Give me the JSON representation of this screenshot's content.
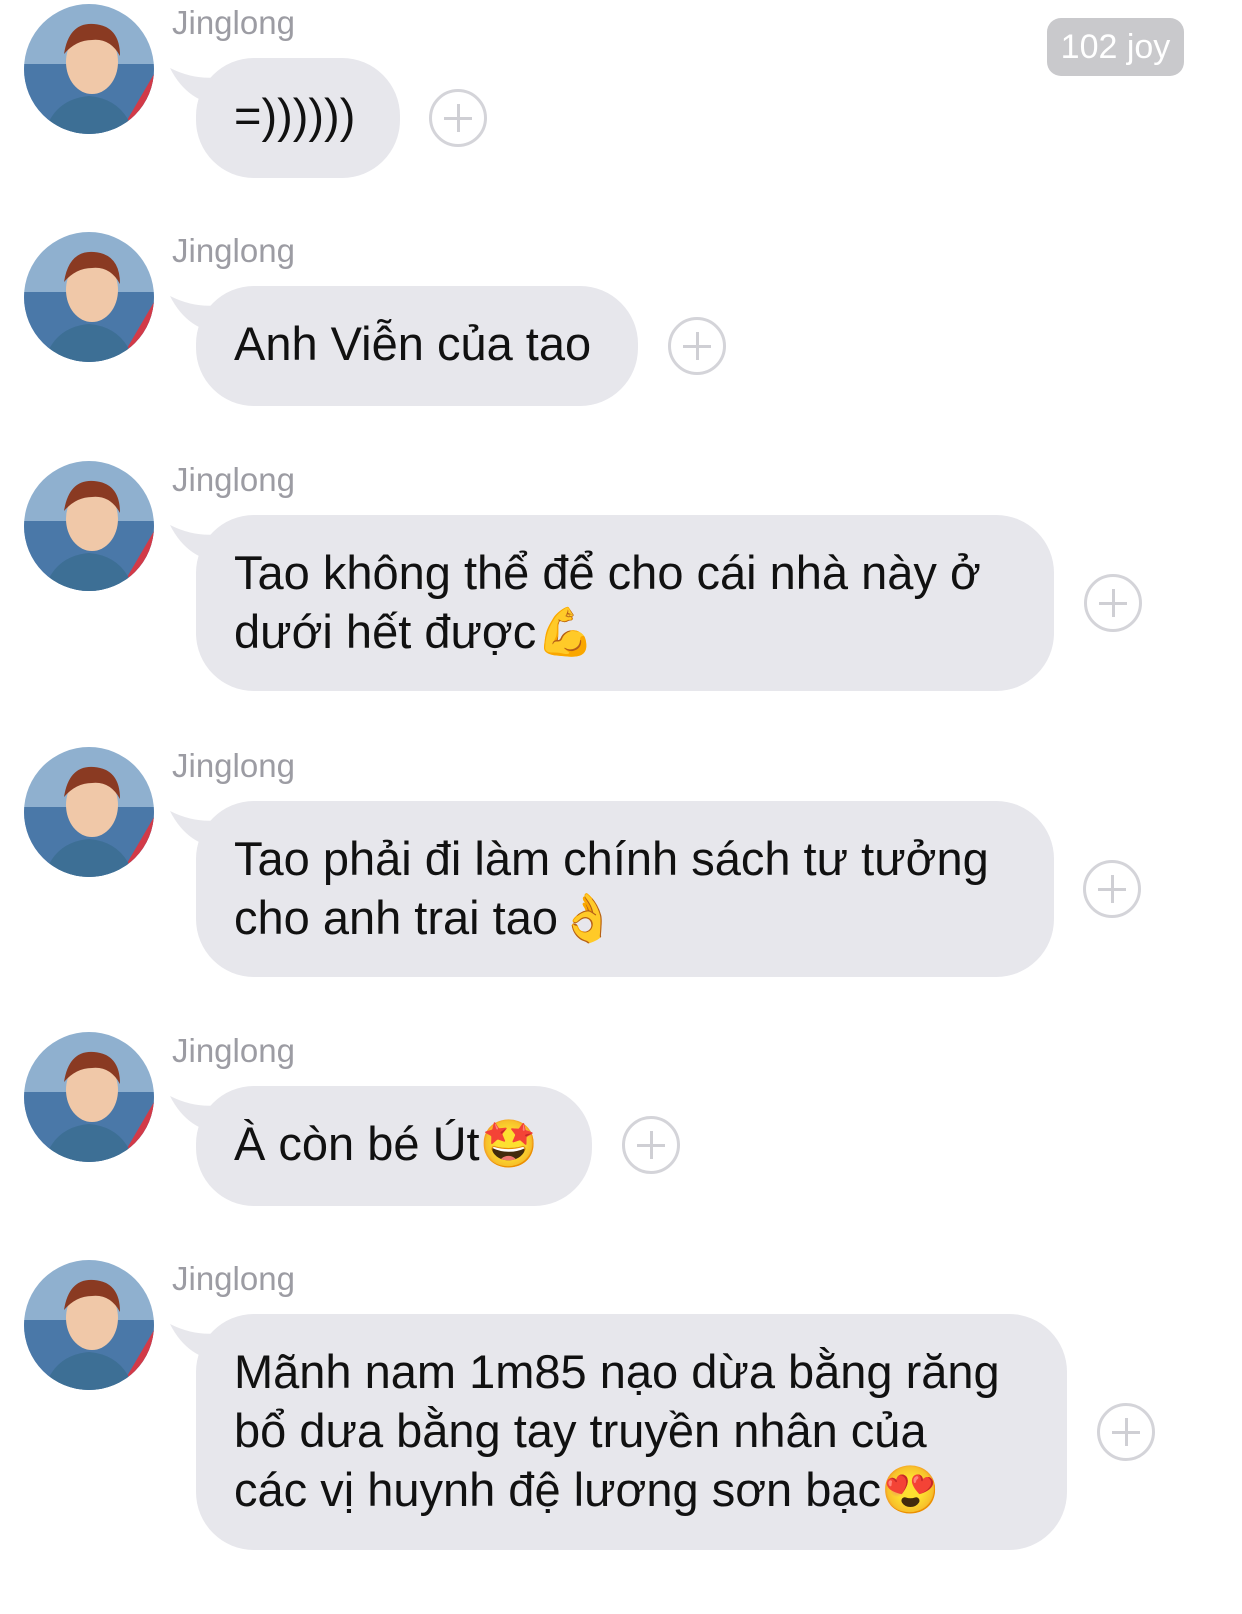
{
  "header": {
    "badge_label": "102 joy"
  },
  "messages": [
    {
      "sender": "Jinglong",
      "lines": [
        "=))))))"
      ]
    },
    {
      "sender": "Jinglong",
      "lines": [
        "Anh Viễn của tao"
      ]
    },
    {
      "sender": "Jinglong",
      "lines": [
        "Tao không thể để cho cái nhà này ở",
        "dưới hết được💪"
      ]
    },
    {
      "sender": "Jinglong",
      "lines": [
        "Tao phải đi làm chính sách tư tưởng",
        "cho anh trai tao👌"
      ]
    },
    {
      "sender": "Jinglong",
      "lines": [
        "À còn bé Út🤩"
      ]
    },
    {
      "sender": "Jinglong",
      "lines": [
        "Mãnh nam 1m85 nạo dừa bằng răng",
        "bổ dưa bằng tay truyền nhân của",
        "các vị huynh đệ lương sơn bạc😍"
      ]
    }
  ],
  "icons": {
    "reaction": "add-reaction-icon",
    "avatar": "avatar-photo"
  },
  "colors": {
    "bubble": "#e7e7ec",
    "sender": "#9c9ca3",
    "badge": "#c9c9cc"
  }
}
